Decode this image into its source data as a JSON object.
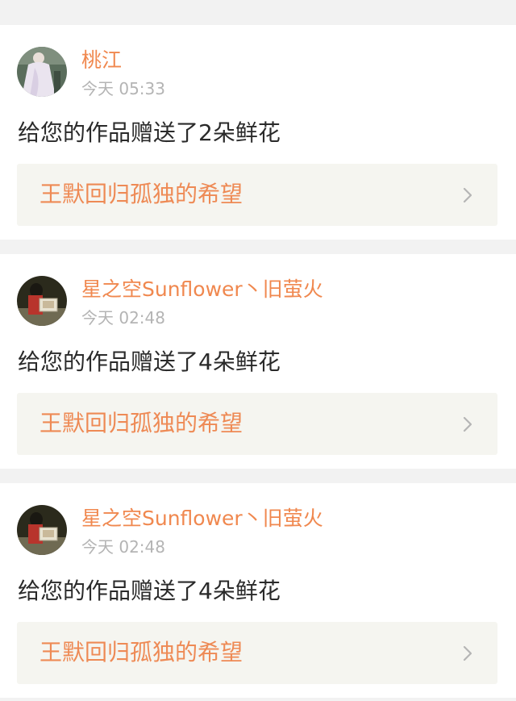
{
  "notifications": [
    {
      "username": "桃江",
      "time": "今天 05:33",
      "message": "给您的作品赠送了2朵鲜花",
      "work_title": "王默回归孤独的希望"
    },
    {
      "username": "星之空Sunflower丶旧萤火",
      "time": "今天 02:48",
      "message": "给您的作品赠送了4朵鲜花",
      "work_title": "王默回归孤独的希望"
    },
    {
      "username": "星之空Sunflower丶旧萤火",
      "time": "今天 02:48",
      "message": "给您的作品赠送了4朵鲜花",
      "work_title": "王默回归孤独的希望"
    }
  ],
  "colors": {
    "username": "#f0884f",
    "work_title": "#ee8a55",
    "timestamp": "#b4b4b4",
    "link_background": "#f5f5f0"
  },
  "icons": {
    "chevron": "chevron-right-icon"
  }
}
